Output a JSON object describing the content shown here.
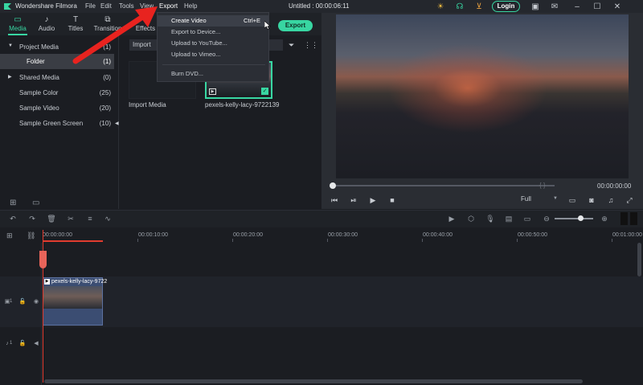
{
  "app": {
    "name": "Wondershare Filmora"
  },
  "menu": [
    "File",
    "Edit",
    "Tools",
    "View",
    "Export",
    "Help"
  ],
  "document_title": "Untitled : 00:00:06:11",
  "login_label": "Login",
  "tabs": [
    {
      "label": "Media",
      "icon": "folder-icon"
    },
    {
      "label": "Audio",
      "icon": "music-note-icon"
    },
    {
      "label": "Titles",
      "icon": "text-T-icon"
    },
    {
      "label": "Transition",
      "icon": "transition-icon"
    },
    {
      "label": "Effects",
      "icon": "effects-icon"
    }
  ],
  "export_button": "Export",
  "project_tree": [
    {
      "label": "Project Media",
      "count": "(1)",
      "expanded": true
    },
    {
      "label": "Folder",
      "count": "(1)",
      "selected": true
    },
    {
      "label": "Shared Media",
      "count": "(0)"
    },
    {
      "label": "Sample Color",
      "count": "(25)"
    },
    {
      "label": "Sample Video",
      "count": "(20)"
    },
    {
      "label": "Sample Green Screen",
      "count": "(10)"
    }
  ],
  "media": {
    "import_label": "Import",
    "import_media_label": "Import Media",
    "clip_name": "pexels-kelly-lacy-9722139"
  },
  "export_menu": {
    "items": [
      {
        "label": "Create Video",
        "shortcut": "Ctrl+E",
        "highlighted": true
      },
      {
        "label": "Export to Device..."
      },
      {
        "label": "Upload to YouTube..."
      },
      {
        "label": "Upload to Vimeo..."
      },
      {
        "label": "Burn DVD..."
      }
    ]
  },
  "preview": {
    "timecode": "00:00:00:00",
    "quality": "Full",
    "brackets": "{ }"
  },
  "timeline": {
    "ticks": [
      "00:00:00:00",
      "00:00:10:00",
      "00:00:20:00",
      "00:00:30:00",
      "00:00:40:00",
      "00:00:50:00",
      "00:01:00:00"
    ],
    "clip_label": "pexels-kelly-lacy-9722",
    "video_track_label": "1",
    "audio_track_label": "1"
  },
  "colors": {
    "accent": "#38d6a2",
    "playhead": "#e23c2f"
  }
}
